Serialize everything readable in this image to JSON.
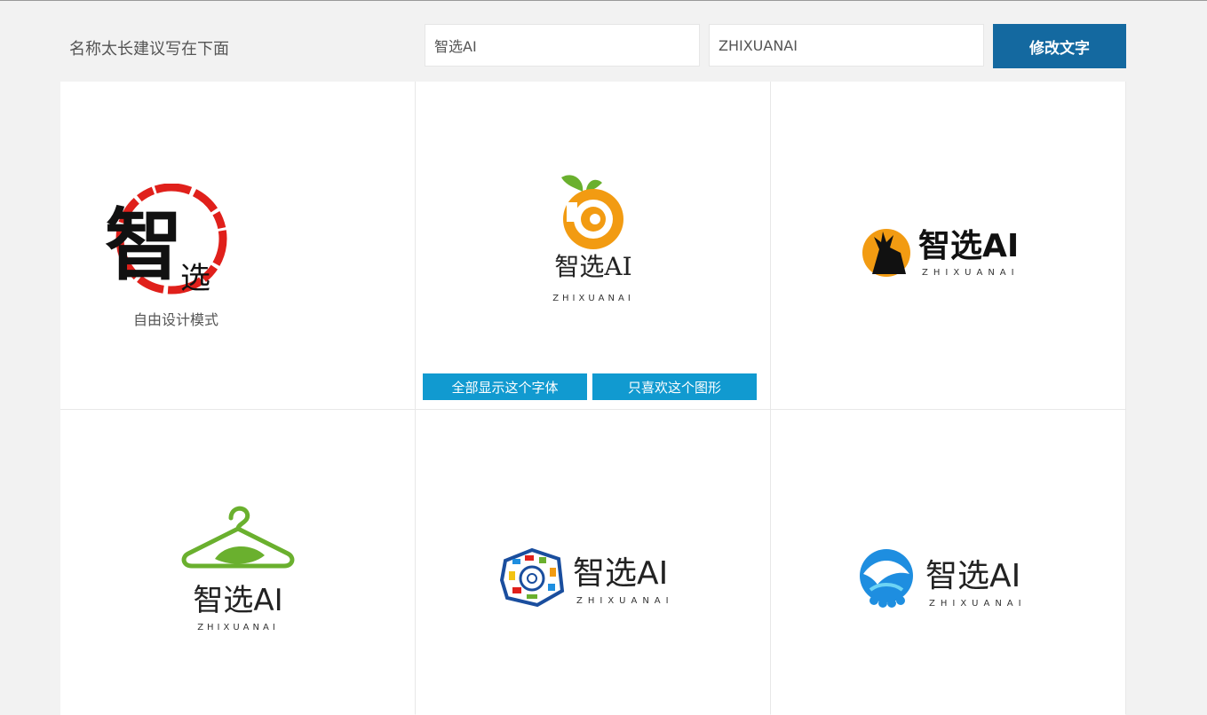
{
  "header": {
    "hint": "名称太长建议写在下面",
    "name_input": {
      "value": "智选AI",
      "placeholder": ""
    },
    "slogan_input": {
      "value": "ZHIXUANAI",
      "placeholder": ""
    },
    "modify_button": "修改文字"
  },
  "cards": [
    {
      "mode_label": "自由设计模式",
      "seal_text_1": "智",
      "seal_text_2": "选"
    },
    {
      "name": "智选AI",
      "sub": "ZHIXUANAI",
      "action_font": "全部显示这个字体",
      "action_shape": "只喜欢这个图形"
    },
    {
      "name": "智选AI",
      "sub": "ZHIXUANAI"
    },
    {
      "name": "智选AI",
      "sub": "ZHIXUANAI"
    },
    {
      "name": "智选AI",
      "sub": "ZHIXUANAI"
    },
    {
      "name": "智选AI",
      "sub": "ZHIXUANAI"
    }
  ],
  "colors": {
    "modify_button": "#1469a0",
    "action_button": "#119ad0",
    "seal_red": "#e0201b",
    "orange": "#f29b12",
    "green": "#6ab02e",
    "blue": "#1e8ee0"
  }
}
